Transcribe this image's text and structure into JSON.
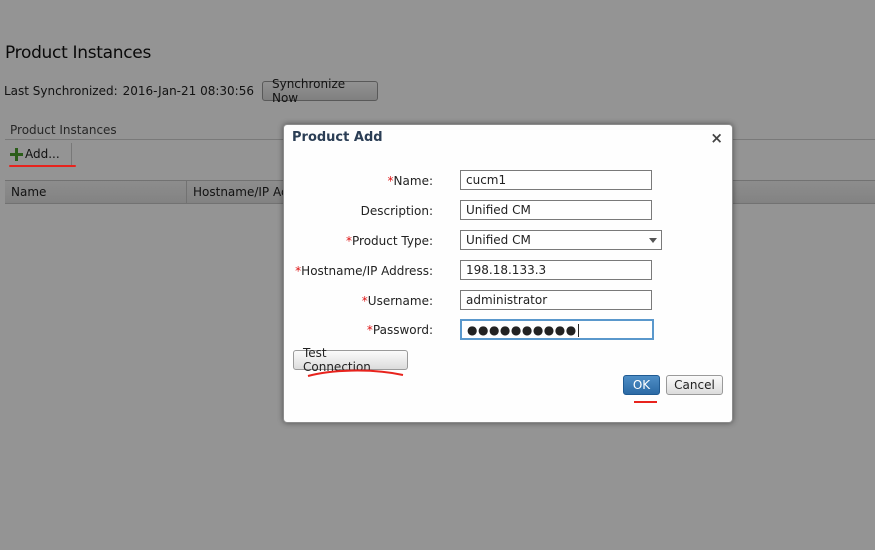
{
  "page": {
    "title": "Product Instances",
    "last_synchronized_label": "Last Synchronized:",
    "last_synchronized_value": "2016-Jan-21 08:30:56",
    "synchronize_button": "Synchronize Now",
    "section_title": "Product Instances",
    "add_button": "Add...",
    "grid_columns": [
      "Name",
      "Hostname/IP Ac"
    ]
  },
  "dialog": {
    "title": "Product Add",
    "close_glyph": "×",
    "fields": {
      "name": {
        "label": "Name:",
        "required": "*",
        "value": "cucm1"
      },
      "description": {
        "label": "Description:",
        "value": "Unified CM"
      },
      "product_type": {
        "label": "Product Type:",
        "required": "*",
        "value": "Unified CM"
      },
      "hostname": {
        "label": "Hostname/IP Address:",
        "required": "*",
        "value": "198.18.133.3"
      },
      "username": {
        "label": "Username:",
        "required": "*",
        "value": "administrator"
      },
      "password": {
        "label": "Password:",
        "required": "*",
        "value": "●●●●●●●●●●"
      }
    },
    "test_connection_button": "Test Connection",
    "ok_button": "OK",
    "cancel_button": "Cancel"
  },
  "colors": {
    "annotation": "#e8231d",
    "ok_button": "#2c6aa5",
    "dialog_title": "#2b3e55",
    "required_marker": "#dd1111"
  },
  "icons": {
    "add": "plus-icon",
    "close": "close-icon",
    "dropdown": "chevron-down-icon"
  }
}
